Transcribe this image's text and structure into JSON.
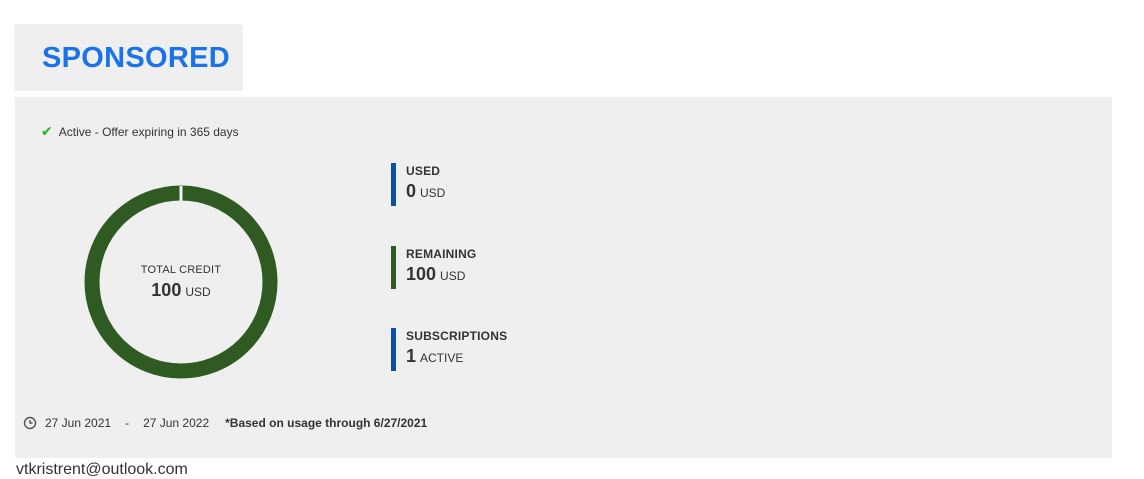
{
  "tab": {
    "title": "SPONSORED"
  },
  "status": {
    "check": "✔",
    "text": "Active - Offer expiring in 365 days"
  },
  "donut": {
    "label": "TOTAL CREDIT",
    "value": "100",
    "unit": "USD",
    "used_fraction": 0.0,
    "ring_color": "#2f5b23"
  },
  "stats": {
    "used": {
      "label": "USED",
      "value": "0",
      "unit": "USD",
      "color": "#0a4fa3"
    },
    "remaining": {
      "label": "REMAINING",
      "value": "100",
      "unit": "USD",
      "color": "#2f5b23"
    },
    "subscriptions": {
      "label": "SUBSCRIPTIONS",
      "value": "1",
      "unit": "ACTIVE",
      "color": "#0a4fa3"
    }
  },
  "footer": {
    "start_date": "27 Jun 2021",
    "separator": "-",
    "end_date": "27 Jun 2022",
    "note": "*Based on usage through 6/27/2021"
  },
  "account": {
    "email": "vtkristrent@outlook.com"
  },
  "colors": {
    "accent": "#1a73e8",
    "panel_bg": "#efefef"
  }
}
